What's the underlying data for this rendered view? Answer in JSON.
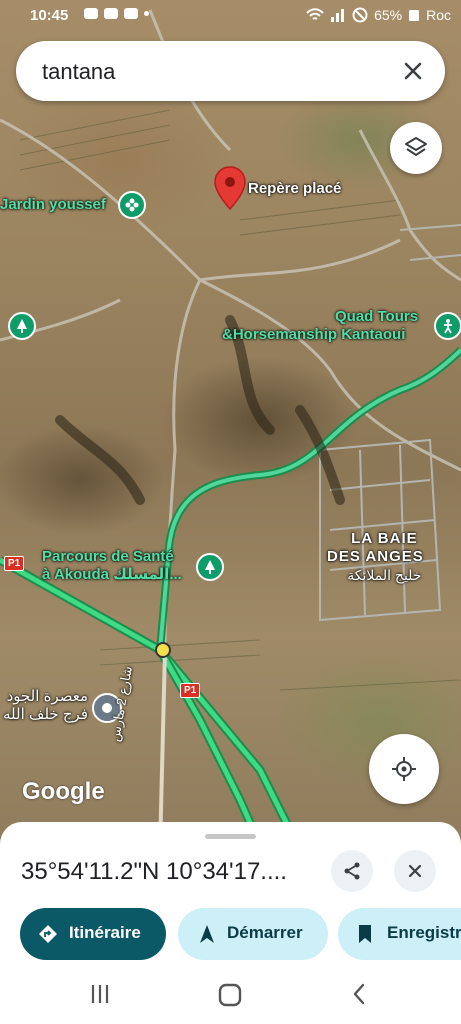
{
  "status_bar": {
    "time": "10:45",
    "battery": "65%",
    "carrier": "Roc"
  },
  "search": {
    "query": "tantana",
    "clear_icon": "close-icon"
  },
  "map": {
    "layers_icon": "layers-icon",
    "pins": {
      "dropped_pin_label": "Repère placé"
    },
    "places": {
      "jardin": "Jardin youssef",
      "quad_line1": "Quad Tours",
      "quad_line2": "&Horsemanship Kantaoui",
      "parcours_line1": "Parcours de Santé",
      "parcours_line2": "à Akouda المسلك...",
      "baie_line1": "LA BAIE",
      "baie_line2": "DES ANGES",
      "baie_arabic": "خليج الملائكة",
      "arabic_place_line1": "معصرة الجود",
      "arabic_place_line2": "فرج خلف الله",
      "street_arabic": "شارع 2 مارس"
    },
    "road_shields": [
      "P1",
      "P1"
    ],
    "attribution": "Google",
    "my_location_icon": "my-location-icon"
  },
  "sheet": {
    "coordinates": "35°54'11.2\"N 10°34'17....",
    "share_icon": "share-icon",
    "close_icon": "close-icon",
    "actions": {
      "route": "Itinéraire",
      "start": "Démarrer",
      "save": "Enregistrer"
    }
  },
  "nav": {
    "recents_icon": "recents-icon",
    "home_icon": "home-icon",
    "back_icon": "back-icon"
  },
  "colors": {
    "accent_dark": "#0b5866",
    "chip_light": "#cdeff7",
    "pin_red": "#e53935",
    "poi_green": "#0e9c68",
    "road_green": "#3ddc84"
  }
}
